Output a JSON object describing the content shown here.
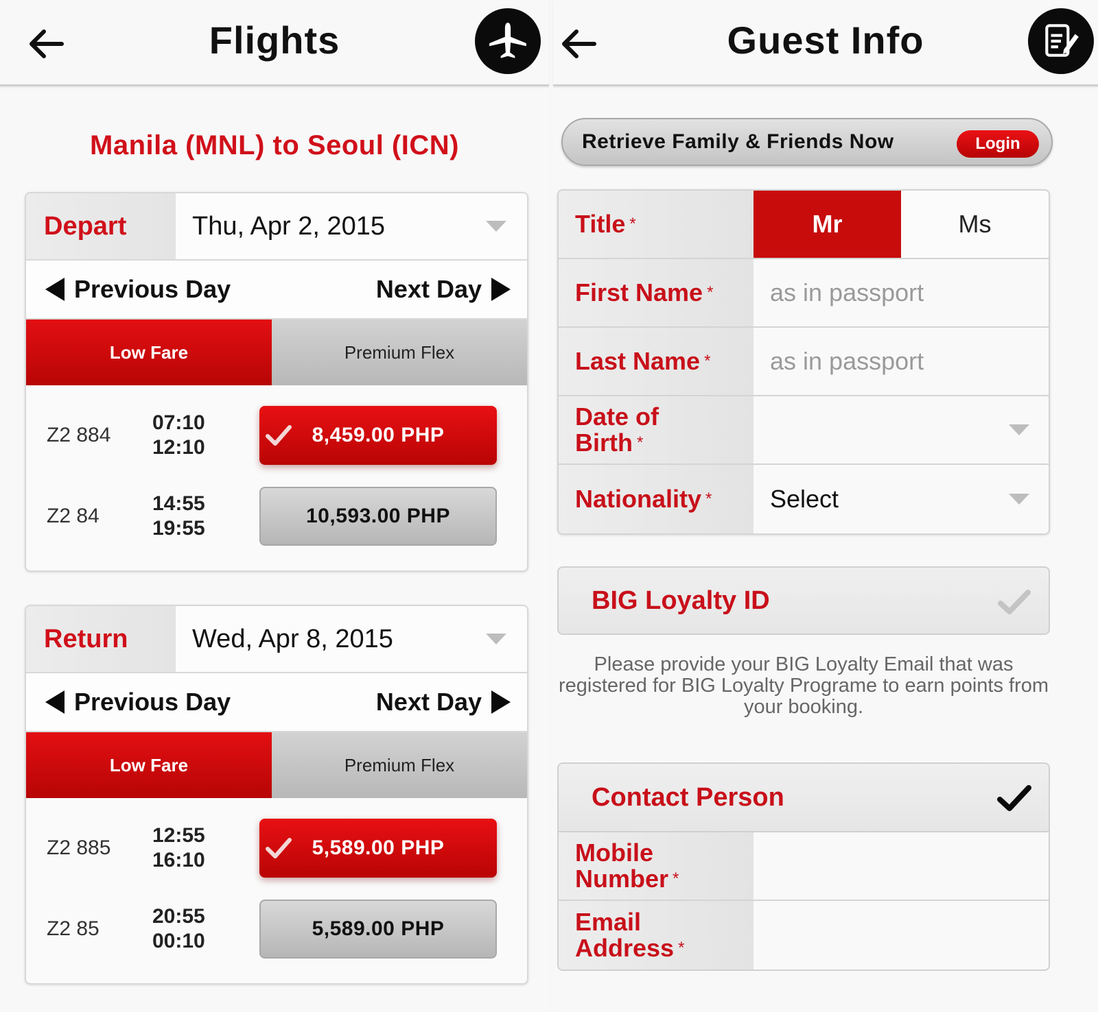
{
  "flights_screen": {
    "header": {
      "title": "Flights",
      "back_icon": "arrow-left-icon",
      "badge_icon": "airplane-icon"
    },
    "route": "Manila (MNL) to Seoul (ICN)",
    "depart": {
      "label": "Depart",
      "date": "Thu, Apr 2, 2015",
      "previous_day": "Previous Day",
      "next_day": "Next Day",
      "tabs": [
        {
          "label": "Low Fare",
          "active": true
        },
        {
          "label": "Premium Flex",
          "active": false
        }
      ],
      "flights": [
        {
          "number": "Z2 884",
          "depart": "07:10",
          "arrive": "12:10",
          "price": "8,459.00 PHP",
          "selected": true
        },
        {
          "number": "Z2 84",
          "depart": "14:55",
          "arrive": "19:55",
          "price": "10,593.00 PHP",
          "selected": false
        }
      ]
    },
    "return": {
      "label": "Return",
      "date": "Wed, Apr 8, 2015",
      "previous_day": "Previous Day",
      "next_day": "Next Day",
      "tabs": [
        {
          "label": "Low Fare",
          "active": true
        },
        {
          "label": "Premium Flex",
          "active": false
        }
      ],
      "flights": [
        {
          "number": "Z2 885",
          "depart": "12:55",
          "arrive": "16:10",
          "price": "5,589.00 PHP",
          "selected": true
        },
        {
          "number": "Z2 85",
          "depart": "20:55",
          "arrive": "00:10",
          "price": "5,589.00 PHP",
          "selected": false
        }
      ]
    }
  },
  "guest_screen": {
    "header": {
      "title": "Guest Info",
      "back_icon": "arrow-left-icon",
      "badge_icon": "edit-document-icon"
    },
    "retrieve": {
      "text": "Retrieve Family & Friends Now",
      "login_label": "Login"
    },
    "form": {
      "title_label": "Title",
      "title_options": [
        {
          "label": "Mr",
          "selected": true
        },
        {
          "label": "Ms",
          "selected": false
        }
      ],
      "first_name_label": "First Name",
      "first_name_placeholder": "as in passport",
      "last_name_label": "Last Name",
      "last_name_placeholder": "as in passport",
      "dob_label_line1": "Date of",
      "dob_label_line2": "Birth",
      "dob_value": "",
      "nationality_label": "Nationality",
      "nationality_value": "Select",
      "required_mark": "*"
    },
    "loyalty": {
      "title": "BIG Loyalty ID",
      "note": "Please provide your BIG Loyalty Email that was registered for BIG Loyalty Programe to earn points from your booking."
    },
    "contact": {
      "title": "Contact Person",
      "mobile_label_line1": "Mobile",
      "mobile_label_line2": "Number",
      "email_label_line1": "Email",
      "email_label_line2": "Address",
      "required_mark": "*"
    }
  },
  "colors": {
    "brand_red": "#d0101a",
    "selected_red": "#c80c0c",
    "badge_black": "#0b0b0b"
  }
}
